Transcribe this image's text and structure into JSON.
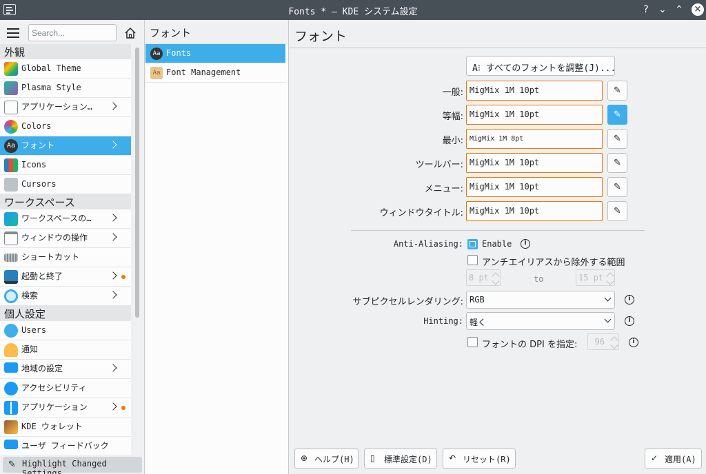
{
  "window": {
    "title": "Fonts * — KDE システム設定"
  },
  "sidebar": {
    "search_placeholder": "Search...",
    "categories": {
      "appearance": "外観",
      "workspace": "ワークスペース",
      "personal": "個人設定"
    },
    "appearance_items": [
      {
        "label": "Global Theme",
        "icon": "global-theme-icon",
        "color": "#e74c3c"
      },
      {
        "label": "Plasma Style",
        "icon": "plasma-style-icon",
        "color": "#1abc9c"
      },
      {
        "label": "アプリケーション…",
        "icon": "application-style-icon",
        "color": "#31363b"
      },
      {
        "label": "Colors",
        "icon": "colors-icon",
        "color": "#9b59b6"
      },
      {
        "label": "フォント",
        "icon": "fonts-icon",
        "color": "#31363b"
      },
      {
        "label": "Icons",
        "icon": "icons-icon",
        "color": "#2980b9"
      },
      {
        "label": "Cursors",
        "icon": "cursors-icon",
        "color": "#7f8c8d"
      }
    ],
    "workspace_items": [
      {
        "label": "ワークスペースの…",
        "icon": "workspace-icon",
        "color": "#1d99f3"
      },
      {
        "label": "ウィンドウの操作",
        "icon": "window-management-icon",
        "color": "#bdc3c7"
      },
      {
        "label": "ショートカット",
        "icon": "keyboard-icon",
        "color": "#95a5a6"
      },
      {
        "label": "起動と終了",
        "icon": "startup-icon",
        "color": "#2980b9"
      },
      {
        "label": "検索",
        "icon": "search-icon",
        "color": "#3daee9"
      }
    ],
    "personal_items": [
      {
        "label": "Users",
        "icon": "users-icon",
        "color": "#3daee9"
      },
      {
        "label": "通知",
        "icon": "bell-icon",
        "color": "#fdbc4b"
      },
      {
        "label": "地域の設定",
        "icon": "regional-icon",
        "color": "#1d99f3"
      },
      {
        "label": "アクセシビリティ",
        "icon": "accessibility-icon",
        "color": "#1d99f3"
      },
      {
        "label": "アプリケーション",
        "icon": "applications-icon",
        "color": "#1d99f3"
      },
      {
        "label": "KDE ウォレット",
        "icon": "wallet-icon",
        "color": "#8e5b2f"
      },
      {
        "label": "ユーザ フィードバック",
        "icon": "feedback-icon",
        "color": "#1d99f3"
      }
    ],
    "highlight_label": "Highlight Changed Settings"
  },
  "middle": {
    "header": "フォント",
    "items": [
      {
        "label": "Fonts",
        "icon": "fonts-icon"
      },
      {
        "label": "Font Management",
        "icon": "font-management-icon"
      }
    ]
  },
  "content": {
    "title": "フォント",
    "adjust_all": "すべてのフォントを調整(J)...",
    "fonts": [
      {
        "label": "一般:",
        "value": "MigMix 1M 10pt"
      },
      {
        "label": "等幅:",
        "value": "MigMix 1M 10pt"
      },
      {
        "label": "最小:",
        "value": "MigMix 1M 8pt"
      },
      {
        "label": "ツールバー:",
        "value": "MigMix 1M 10pt"
      },
      {
        "label": "メニュー:",
        "value": "MigMix 1M 10pt"
      },
      {
        "label": "ウィンドウタイトル:",
        "value": "MigMix 1M 10pt"
      }
    ],
    "antialiasing": {
      "label": "Anti-Aliasing:",
      "enable": "Enable",
      "exclude": "アンチエイリアスから除外する範囲",
      "from": "8 pt",
      "to_label": "to",
      "to": "15 pt"
    },
    "subpixel": {
      "label": "サブピクセルレンダリング:",
      "value": "RGB"
    },
    "hinting": {
      "label": "Hinting:",
      "value": "軽く"
    },
    "dpi": {
      "label": "フォントの DPI を指定:",
      "value": "96"
    }
  },
  "buttons": {
    "help": "ヘルプ(H)",
    "defaults": "標準設定(D)",
    "reset": "リセット(R)",
    "apply": "適用(A)"
  }
}
